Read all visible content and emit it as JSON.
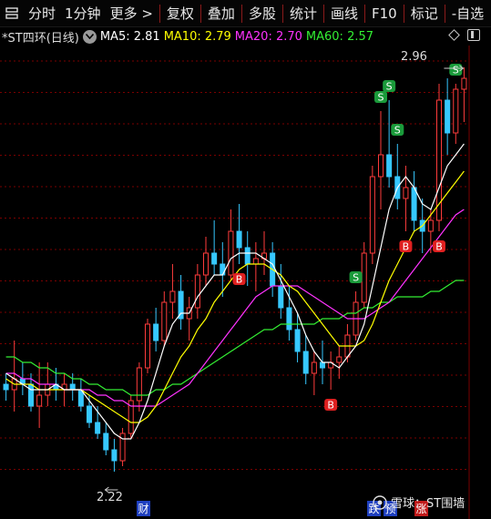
{
  "toolbar": {
    "items": [
      "分时",
      "1分钟",
      "更多 >",
      "复权",
      "叠加",
      "多股",
      "统计",
      "画线",
      "F10",
      "标记",
      "-自选"
    ]
  },
  "infobar": {
    "name": "*ST四环(日线)",
    "ma5": "MA5: 2.81",
    "ma10": "MA10: 2.79",
    "ma20": "MA20: 2.70",
    "ma60": "MA60: 2.57"
  },
  "annotations": {
    "high_label": "2.96",
    "low_label": "2.22",
    "cai_marker": "财",
    "die_marker": "跌",
    "yu_marker": "预",
    "zhang_marker": "涨",
    "watermark": "雪球：ST围墙",
    "b_mark": "B",
    "s_mark": "S"
  },
  "colors": {
    "up": "#ff3c3c",
    "down": "#36c8ff",
    "ma5": "#ffffff",
    "ma10": "#ffff00",
    "ma20": "#ff33ff",
    "ma60": "#33ee33",
    "grid": "#7a0000",
    "buy": "#e02020",
    "sell": "#1a9a3a"
  },
  "chart_data": {
    "type": "candlestick",
    "high": 2.96,
    "low": 2.22,
    "candles_ohlc": [
      [
        2.38,
        2.4,
        2.35,
        2.37
      ],
      [
        2.37,
        2.46,
        2.33,
        2.39
      ],
      [
        2.39,
        2.42,
        2.36,
        2.38
      ],
      [
        2.38,
        2.4,
        2.33,
        2.34
      ],
      [
        2.34,
        2.42,
        2.3,
        2.36
      ],
      [
        2.36,
        2.42,
        2.34,
        2.38
      ],
      [
        2.38,
        2.41,
        2.35,
        2.37
      ],
      [
        2.37,
        2.4,
        2.34,
        2.38
      ],
      [
        2.38,
        2.4,
        2.35,
        2.37
      ],
      [
        2.37,
        2.39,
        2.33,
        2.34
      ],
      [
        2.34,
        2.36,
        2.3,
        2.31
      ],
      [
        2.31,
        2.34,
        2.28,
        2.29
      ],
      [
        2.29,
        2.31,
        2.25,
        2.26
      ],
      [
        2.26,
        2.28,
        2.22,
        2.24
      ],
      [
        2.24,
        2.3,
        2.23,
        2.29
      ],
      [
        2.29,
        2.36,
        2.28,
        2.35
      ],
      [
        2.35,
        2.42,
        2.33,
        2.41
      ],
      [
        2.41,
        2.5,
        2.4,
        2.49
      ],
      [
        2.49,
        2.52,
        2.44,
        2.46
      ],
      [
        2.46,
        2.55,
        2.45,
        2.53
      ],
      [
        2.53,
        2.6,
        2.5,
        2.55
      ],
      [
        2.55,
        2.58,
        2.48,
        2.5
      ],
      [
        2.5,
        2.54,
        2.46,
        2.52
      ],
      [
        2.52,
        2.6,
        2.5,
        2.58
      ],
      [
        2.58,
        2.65,
        2.56,
        2.62
      ],
      [
        2.62,
        2.68,
        2.58,
        2.6
      ],
      [
        2.6,
        2.64,
        2.54,
        2.58
      ],
      [
        2.58,
        2.7,
        2.57,
        2.66
      ],
      [
        2.66,
        2.71,
        2.6,
        2.63
      ],
      [
        2.63,
        2.66,
        2.56,
        2.6
      ],
      [
        2.6,
        2.64,
        2.55,
        2.61
      ],
      [
        2.61,
        2.66,
        2.58,
        2.62
      ],
      [
        2.62,
        2.64,
        2.54,
        2.56
      ],
      [
        2.56,
        2.6,
        2.5,
        2.52
      ],
      [
        2.52,
        2.56,
        2.46,
        2.48
      ],
      [
        2.48,
        2.51,
        2.42,
        2.44
      ],
      [
        2.44,
        2.47,
        2.38,
        2.4
      ],
      [
        2.4,
        2.44,
        2.36,
        2.42
      ],
      [
        2.42,
        2.46,
        2.38,
        2.41
      ],
      [
        2.41,
        2.44,
        2.37,
        2.42
      ],
      [
        2.42,
        2.45,
        2.39,
        2.43
      ],
      [
        2.43,
        2.49,
        2.42,
        2.47
      ],
      [
        2.47,
        2.55,
        2.46,
        2.53
      ],
      [
        2.53,
        2.64,
        2.52,
        2.62
      ],
      [
        2.62,
        2.78,
        2.6,
        2.76
      ],
      [
        2.76,
        2.88,
        2.7,
        2.8
      ],
      [
        2.8,
        2.9,
        2.74,
        2.76
      ],
      [
        2.76,
        2.82,
        2.7,
        2.72
      ],
      [
        2.72,
        2.78,
        2.66,
        2.74
      ],
      [
        2.74,
        2.77,
        2.66,
        2.68
      ],
      [
        2.68,
        2.72,
        2.62,
        2.66
      ],
      [
        2.66,
        2.7,
        2.62,
        2.68
      ],
      [
        2.68,
        2.93,
        2.66,
        2.9
      ],
      [
        2.9,
        2.94,
        2.8,
        2.84
      ],
      [
        2.84,
        2.93,
        2.82,
        2.92
      ],
      [
        2.92,
        2.96,
        2.86,
        2.94
      ]
    ],
    "ma5": [
      2.4,
      2.39,
      2.38,
      2.37,
      2.37,
      2.37,
      2.38,
      2.37,
      2.37,
      2.37,
      2.35,
      2.33,
      2.31,
      2.29,
      2.28,
      2.28,
      2.31,
      2.35,
      2.4,
      2.45,
      2.49,
      2.51,
      2.51,
      2.54,
      2.56,
      2.58,
      2.58,
      2.61,
      2.62,
      2.62,
      2.62,
      2.61,
      2.6,
      2.57,
      2.54,
      2.51,
      2.47,
      2.44,
      2.42,
      2.42,
      2.41,
      2.43,
      2.45,
      2.49,
      2.56,
      2.63,
      2.7,
      2.74,
      2.76,
      2.74,
      2.71,
      2.7,
      2.74,
      2.78,
      2.8,
      2.82
    ],
    "ma10": [
      2.39,
      2.38,
      2.38,
      2.38,
      2.37,
      2.37,
      2.37,
      2.37,
      2.37,
      2.37,
      2.36,
      2.35,
      2.34,
      2.33,
      2.32,
      2.31,
      2.31,
      2.32,
      2.34,
      2.37,
      2.4,
      2.43,
      2.45,
      2.48,
      2.5,
      2.53,
      2.55,
      2.57,
      2.59,
      2.6,
      2.6,
      2.6,
      2.59,
      2.58,
      2.56,
      2.55,
      2.53,
      2.51,
      2.49,
      2.47,
      2.45,
      2.45,
      2.45,
      2.46,
      2.49,
      2.53,
      2.57,
      2.6,
      2.63,
      2.66,
      2.67,
      2.69,
      2.71,
      2.73,
      2.75,
      2.77
    ],
    "ma20": [
      2.4,
      2.4,
      2.39,
      2.39,
      2.38,
      2.38,
      2.38,
      2.37,
      2.37,
      2.37,
      2.37,
      2.36,
      2.36,
      2.35,
      2.35,
      2.34,
      2.34,
      2.34,
      2.34,
      2.35,
      2.36,
      2.37,
      2.38,
      2.4,
      2.42,
      2.44,
      2.46,
      2.48,
      2.5,
      2.52,
      2.54,
      2.55,
      2.56,
      2.56,
      2.56,
      2.56,
      2.55,
      2.54,
      2.53,
      2.52,
      2.51,
      2.5,
      2.5,
      2.5,
      2.51,
      2.52,
      2.53,
      2.55,
      2.57,
      2.59,
      2.61,
      2.63,
      2.65,
      2.67,
      2.69,
      2.7
    ],
    "ma60": [
      2.43,
      2.43,
      2.42,
      2.42,
      2.41,
      2.41,
      2.4,
      2.4,
      2.39,
      2.39,
      2.38,
      2.38,
      2.37,
      2.37,
      2.37,
      2.36,
      2.36,
      2.36,
      2.37,
      2.37,
      2.38,
      2.38,
      2.39,
      2.4,
      2.41,
      2.42,
      2.43,
      2.44,
      2.45,
      2.46,
      2.47,
      2.48,
      2.48,
      2.49,
      2.49,
      2.49,
      2.49,
      2.49,
      2.5,
      2.5,
      2.5,
      2.51,
      2.51,
      2.52,
      2.52,
      2.53,
      2.53,
      2.54,
      2.54,
      2.54,
      2.54,
      2.55,
      2.55,
      2.56,
      2.57,
      2.57
    ],
    "signals": [
      {
        "type": "B",
        "index": 28
      },
      {
        "type": "B",
        "index": 39
      },
      {
        "type": "S",
        "index": 42
      },
      {
        "type": "S",
        "index": 45
      },
      {
        "type": "S",
        "index": 46
      },
      {
        "type": "S",
        "index": 47
      },
      {
        "type": "B",
        "index": 48
      },
      {
        "type": "B",
        "index": 52
      },
      {
        "type": "S",
        "index": 54
      }
    ]
  }
}
